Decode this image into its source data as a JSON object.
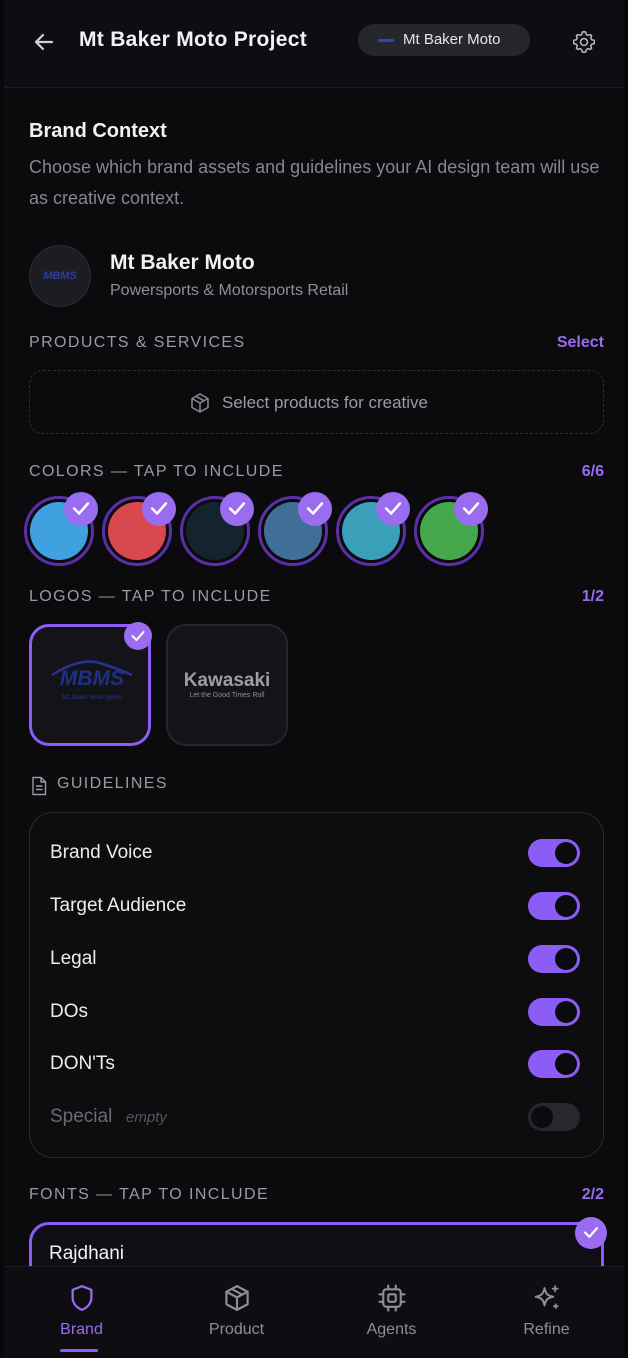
{
  "header": {
    "title": "Mt Baker Moto Project",
    "brand_pill": "Mt Baker Moto"
  },
  "brand_context": {
    "title": "Brand Context",
    "description": "Choose which brand assets and guidelines your AI design team will use as creative context.",
    "avatar_text": "MBMS",
    "brand_name": "Mt Baker Moto",
    "brand_category": "Powersports & Motorsports Retail"
  },
  "products": {
    "section_label": "PRODUCTS & SERVICES",
    "select_action": "Select",
    "placeholder": "Select products for creative"
  },
  "colors": {
    "section_label": "COLORS — TAP TO INCLUDE",
    "count": "6/6",
    "swatches": [
      {
        "hex": "#3fa1df",
        "selected": true
      },
      {
        "hex": "#d9474f",
        "selected": true
      },
      {
        "hex": "#14232e",
        "selected": true
      },
      {
        "hex": "#3f6f96",
        "selected": true
      },
      {
        "hex": "#3a9fb8",
        "selected": true
      },
      {
        "hex": "#46a84c",
        "selected": true
      }
    ]
  },
  "logos": {
    "section_label": "LOGOS — TAP TO INCLUDE",
    "count": "1/2",
    "items": [
      {
        "text": "MBMS",
        "sub": "Mt. Baker Moto Sports",
        "selected": true
      },
      {
        "text": "Kawasaki",
        "sub": "Let the Good Times Roll",
        "selected": false
      }
    ]
  },
  "guidelines": {
    "section_label": "GUIDELINES",
    "items": [
      {
        "label": "Brand Voice",
        "on": true
      },
      {
        "label": "Target Audience",
        "on": true
      },
      {
        "label": "Legal",
        "on": true
      },
      {
        "label": "DOs",
        "on": true
      },
      {
        "label": "DON'Ts",
        "on": true
      },
      {
        "label": "Special",
        "note": "empty",
        "on": false
      }
    ]
  },
  "fonts": {
    "section_label": "FONTS — TAP TO INCLUDE",
    "count": "2/2",
    "items": [
      {
        "name": "Rajdhani",
        "selected": true
      }
    ]
  },
  "nav": {
    "items": [
      {
        "label": "Brand",
        "icon": "shield-icon",
        "active": true
      },
      {
        "label": "Product",
        "icon": "box-icon",
        "active": false
      },
      {
        "label": "Agents",
        "icon": "chip-icon",
        "active": false
      },
      {
        "label": "Refine",
        "icon": "sparkle-icon",
        "active": false
      }
    ]
  },
  "accent": "#8b5cf6"
}
